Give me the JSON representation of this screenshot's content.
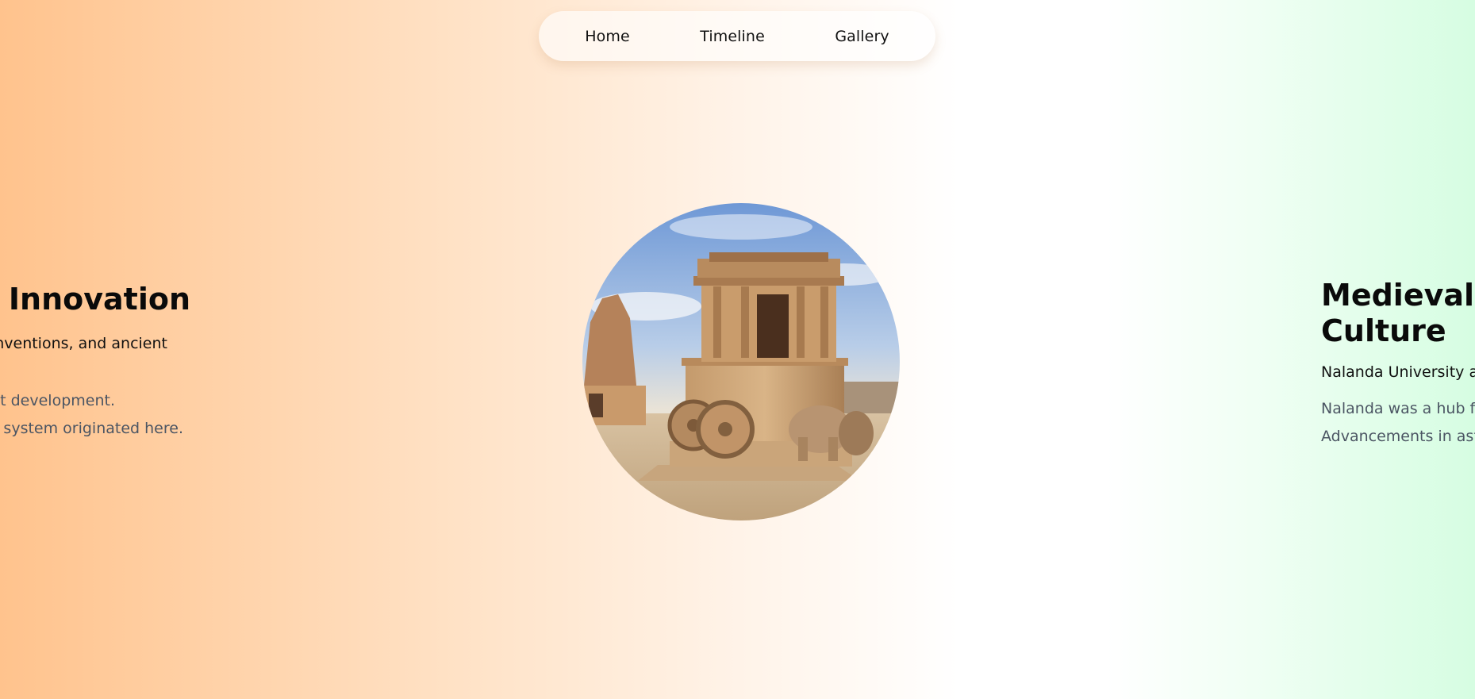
{
  "nav": {
    "items": [
      {
        "label": "Home"
      },
      {
        "label": "Timeline"
      },
      {
        "label": "Gallery"
      }
    ]
  },
  "slide_left": {
    "title": "of Innovation",
    "subtitle": "y inventions, and ancient",
    "lines": [
      "pt development.",
      "nal system originated here."
    ]
  },
  "slide_right": {
    "title_line1": "Medieval In",
    "title_line2": "Culture",
    "subtitle": "Nalanda University and",
    "lines": [
      "Nalanda was a hub for",
      "Advancements in astro"
    ]
  },
  "colors": {
    "bg_left": "#ffc38d",
    "bg_mid": "#ffffff",
    "bg_right": "#d6fde2",
    "desc_text": "#4b5563"
  }
}
